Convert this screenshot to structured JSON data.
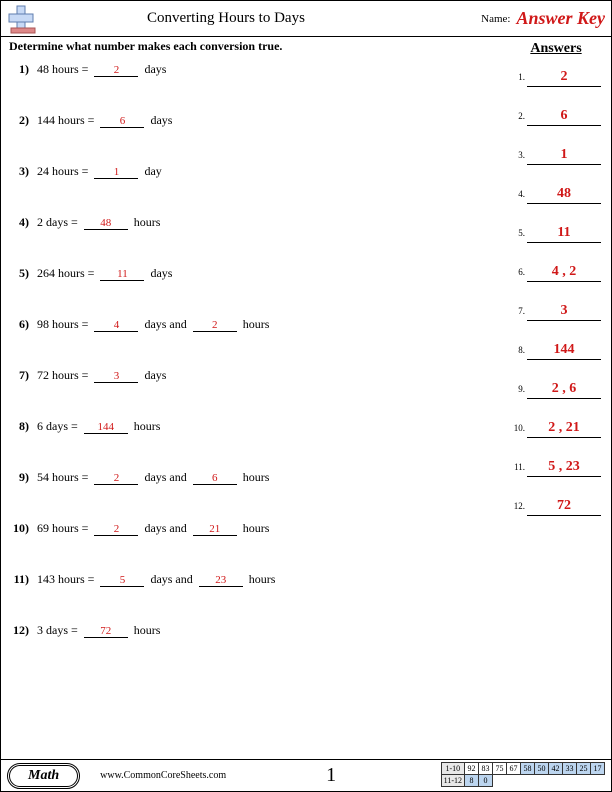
{
  "header": {
    "title": "Converting Hours to Days",
    "name_label": "Name:",
    "answer_key": "Answer Key"
  },
  "instruction": "Determine what number makes each conversion true.",
  "questions": [
    {
      "num": "1)",
      "parts": [
        "48 hours = ",
        {
          "blank": "2"
        },
        " days"
      ]
    },
    {
      "num": "2)",
      "parts": [
        "144 hours = ",
        {
          "blank": "6"
        },
        " days"
      ]
    },
    {
      "num": "3)",
      "parts": [
        "24 hours = ",
        {
          "blank": "1"
        },
        " day"
      ]
    },
    {
      "num": "4)",
      "parts": [
        "2 days = ",
        {
          "blank": "48"
        },
        " hours"
      ]
    },
    {
      "num": "5)",
      "parts": [
        "264 hours = ",
        {
          "blank": "11"
        },
        " days"
      ]
    },
    {
      "num": "6)",
      "parts": [
        "98 hours = ",
        {
          "blank": "4"
        },
        " days and ",
        {
          "blank": "2"
        },
        " hours"
      ]
    },
    {
      "num": "7)",
      "parts": [
        "72 hours = ",
        {
          "blank": "3"
        },
        " days"
      ]
    },
    {
      "num": "8)",
      "parts": [
        "6 days = ",
        {
          "blank": "144"
        },
        " hours"
      ]
    },
    {
      "num": "9)",
      "parts": [
        "54 hours = ",
        {
          "blank": "2"
        },
        " days and ",
        {
          "blank": "6"
        },
        " hours"
      ]
    },
    {
      "num": "10)",
      "parts": [
        "69 hours = ",
        {
          "blank": "2"
        },
        " days and ",
        {
          "blank": "21"
        },
        " hours"
      ]
    },
    {
      "num": "11)",
      "parts": [
        "143 hours = ",
        {
          "blank": "5"
        },
        " days and ",
        {
          "blank": "23"
        },
        " hours"
      ]
    },
    {
      "num": "12)",
      "parts": [
        "3 days = ",
        {
          "blank": "72"
        },
        " hours"
      ]
    }
  ],
  "answers_title": "Answers",
  "answers": [
    {
      "num": "1.",
      "val": "2"
    },
    {
      "num": "2.",
      "val": "6"
    },
    {
      "num": "3.",
      "val": "1"
    },
    {
      "num": "4.",
      "val": "48"
    },
    {
      "num": "5.",
      "val": "11"
    },
    {
      "num": "6.",
      "val": "4 , 2"
    },
    {
      "num": "7.",
      "val": "3"
    },
    {
      "num": "8.",
      "val": "144"
    },
    {
      "num": "9.",
      "val": "2 , 6"
    },
    {
      "num": "10.",
      "val": "2 , 21"
    },
    {
      "num": "11.",
      "val": "5 , 23"
    },
    {
      "num": "12.",
      "val": "72"
    }
  ],
  "footer": {
    "subject": "Math",
    "url": "www.CommonCoreSheets.com",
    "page": "1"
  },
  "score_grid": {
    "row1_label": "1-10",
    "row1": [
      "92",
      "83",
      "75",
      "67",
      "58",
      "50",
      "42",
      "33",
      "25",
      "17"
    ],
    "row2_label": "11-12",
    "row2": [
      "8",
      "0"
    ]
  },
  "colors": {
    "red": "#d01818"
  }
}
